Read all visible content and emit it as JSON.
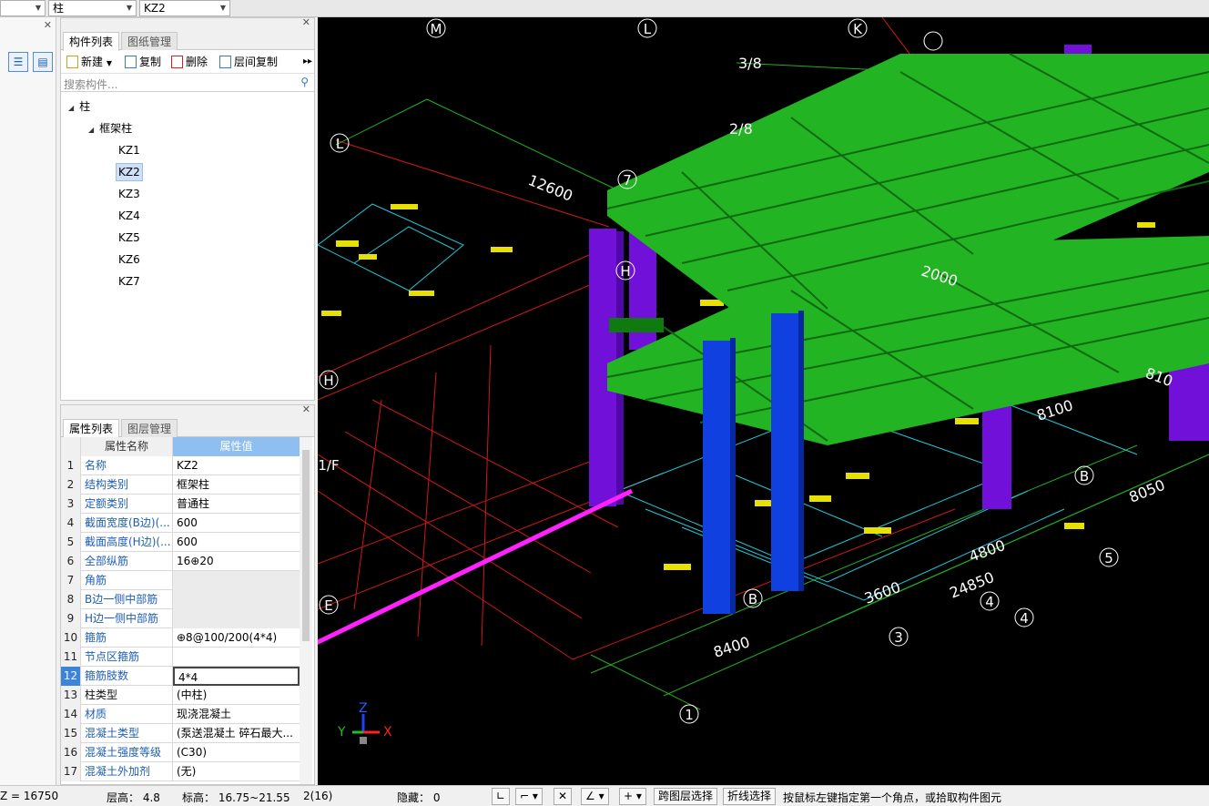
{
  "topbar": {
    "combo1_value": "",
    "combo2_value": "柱",
    "combo3_value": "KZ2"
  },
  "component_panel": {
    "tabs": [
      "构件列表",
      "图纸管理"
    ],
    "toolbar": {
      "new_label": "新建",
      "copy_label": "复制",
      "delete_label": "删除",
      "floor_copy_label": "层间复制"
    },
    "search_placeholder": "搜索构件...",
    "tree": {
      "root": "柱",
      "group": "框架柱",
      "items": [
        "KZ1",
        "KZ2",
        "KZ3",
        "KZ4",
        "KZ5",
        "KZ6",
        "KZ7"
      ],
      "selected": "KZ2"
    }
  },
  "property_panel": {
    "tabs": [
      "属性列表",
      "图层管理"
    ],
    "header": {
      "name": "属性名称",
      "value": "属性值"
    },
    "rows": [
      {
        "no": "1",
        "name": "名称",
        "value": "KZ2"
      },
      {
        "no": "2",
        "name": "结构类别",
        "value": "框架柱"
      },
      {
        "no": "3",
        "name": "定额类别",
        "value": "普通柱"
      },
      {
        "no": "4",
        "name": "截面宽度(B边)(...",
        "value": "600"
      },
      {
        "no": "5",
        "name": "截面高度(H边)(...",
        "value": "600"
      },
      {
        "no": "6",
        "name": "全部纵筋",
        "value": "16⊕20"
      },
      {
        "no": "7",
        "name": "角筋",
        "value": ""
      },
      {
        "no": "8",
        "name": "B边一侧中部筋",
        "value": ""
      },
      {
        "no": "9",
        "name": "H边一侧中部筋",
        "value": ""
      },
      {
        "no": "10",
        "name": "箍筋",
        "value": "⊕8@100/200(4*4)"
      },
      {
        "no": "11",
        "name": "节点区箍筋",
        "value": ""
      },
      {
        "no": "12",
        "name": "箍筋肢数",
        "value": "4*4"
      },
      {
        "no": "13",
        "name": "柱类型",
        "value": "(中柱)"
      },
      {
        "no": "14",
        "name": "材质",
        "value": "现浇混凝土"
      },
      {
        "no": "15",
        "name": "混凝土类型",
        "value": "(泵送混凝土 碎石最大..."
      },
      {
        "no": "16",
        "name": "混凝土强度等级",
        "value": "(C30)"
      },
      {
        "no": "17",
        "name": "混凝土外加剂",
        "value": "(无)"
      }
    ]
  },
  "viewport": {
    "axis_labels": [
      "M",
      "L",
      "K",
      "L",
      "H",
      "1/F",
      "E",
      "B",
      "B",
      "1",
      "3",
      "4",
      "4",
      "5",
      "7",
      "H"
    ],
    "dimension_labels": [
      "3/8",
      "2/8",
      "12600",
      "2000",
      "8100",
      "810",
      "8050",
      "4800",
      "24850",
      "3600",
      "8400"
    ],
    "axis_triad": {
      "z": "Z",
      "y": "Y",
      "x": "X"
    },
    "colors": {
      "beams": "#22b422",
      "columns_purple": "#7010d8",
      "columns_blue": "#1040e0",
      "arrow": "#ff22ff"
    }
  },
  "statusbar": {
    "z_value": "Z = 16750",
    "floor_height": "层高：  4.8",
    "elevation": "标高：  16.75~21.55",
    "count": "2(16)",
    "hidden": "隐藏：  0",
    "cross_floor_select": "跨图层选择",
    "polyline_select": "折线选择",
    "hint": "按鼠标左键指定第一个角点，或拾取构件图元"
  }
}
